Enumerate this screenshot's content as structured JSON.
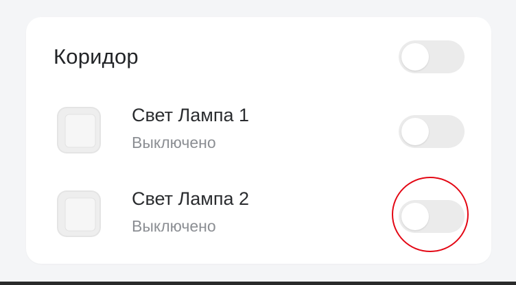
{
  "room": {
    "title": "Коридор",
    "toggle_on": false
  },
  "devices": [
    {
      "name": "Свет Лампа 1",
      "status": "Выключено",
      "toggle_on": false,
      "icon": "light-switch-icon"
    },
    {
      "name": "Свет Лампа 2",
      "status": "Выключено",
      "toggle_on": false,
      "icon": "light-switch-icon"
    }
  ],
  "colors": {
    "background": "#f4f5f7",
    "card": "#ffffff",
    "toggle_off_track": "#ebebeb",
    "highlight": "#e30613"
  }
}
